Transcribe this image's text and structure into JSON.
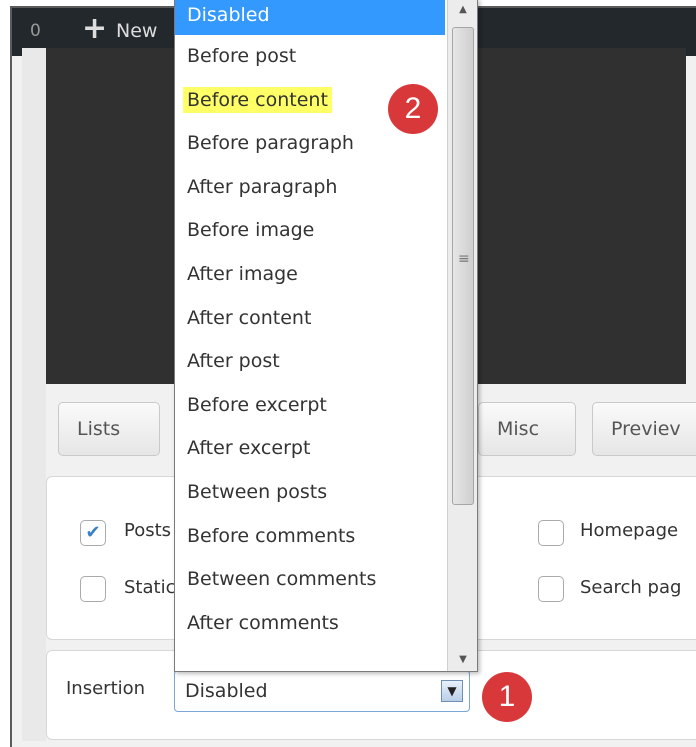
{
  "admin_bar": {
    "count": "0",
    "new_label": "New"
  },
  "tabs": [
    {
      "label": "Lists"
    },
    {
      "label": "Misc"
    },
    {
      "label": "Previev"
    }
  ],
  "pages": {
    "posts": {
      "label": "Posts",
      "checked": true
    },
    "static": {
      "label": "Static",
      "checked": false
    },
    "homepage": {
      "label": "Homepage",
      "checked": false
    },
    "search": {
      "label": "Search pag",
      "checked": false
    }
  },
  "insertion": {
    "label": "Insertion",
    "selected": "Disabled",
    "options": [
      "Disabled",
      "Before post",
      "Before content",
      "Before paragraph",
      "After paragraph",
      "Before image",
      "After image",
      "After content",
      "After post",
      "Before excerpt",
      "After excerpt",
      "Between posts",
      "Before comments",
      "Between comments",
      "After comments"
    ]
  },
  "badges": {
    "one": "1",
    "two": "2"
  },
  "colors": {
    "highlight_selected": "#3399ff",
    "highlight_marker": "#ffff66",
    "badge": "#d9383b"
  }
}
